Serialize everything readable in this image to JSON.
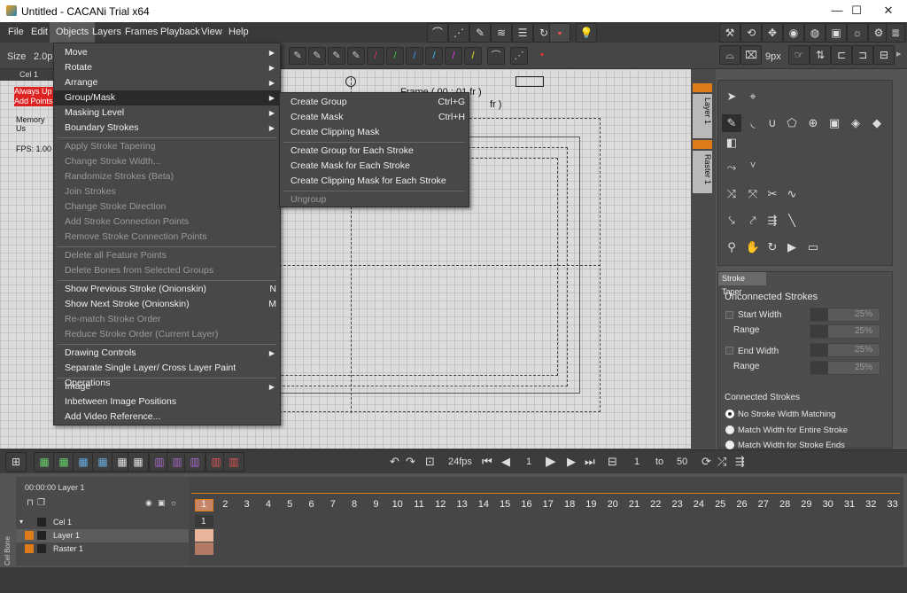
{
  "window": {
    "title": "Untitled - CACANi Trial  x64",
    "minimize": "—",
    "maximize": "☐",
    "close": "✕"
  },
  "menubar": {
    "items": [
      "File",
      "Edit",
      "Objects",
      "Layers",
      "Frames",
      "Playback",
      "View",
      "Help"
    ],
    "active": "Objects"
  },
  "toolbar": {
    "size_label": "Size",
    "size_value": "2.0px",
    "brush_size": "9px"
  },
  "left_info": {
    "cel_label": "Cel 1",
    "always_up": "Always Up",
    "add_points": "Add Points",
    "memory": "Memory Us",
    "fps": "FPS: 1.00"
  },
  "canvas": {
    "frame_text": "Frame ( 00 : 01 fr )",
    "fr_text": "fr )"
  },
  "right_tabs": {
    "layer1": "Layer 1",
    "raster1": "Raster 1"
  },
  "objects_menu": [
    {
      "label": "Move",
      "arrow": true,
      "disabled": false
    },
    {
      "label": "Rotate",
      "arrow": true,
      "disabled": false
    },
    {
      "label": "Arrange",
      "arrow": true,
      "disabled": false
    },
    {
      "label": "Group/Mask",
      "arrow": true,
      "disabled": false,
      "selected": true
    },
    {
      "label": "Masking Level",
      "arrow": true,
      "disabled": false
    },
    {
      "label": "Boundary Strokes",
      "arrow": true,
      "disabled": false
    },
    {
      "label": "Apply Stroke Tapering",
      "disabled": true
    },
    {
      "label": "Change Stroke Width...",
      "disabled": true
    },
    {
      "label": "Randomize Strokes (Beta)",
      "disabled": true
    },
    {
      "label": "Join Strokes",
      "disabled": true
    },
    {
      "label": "Change Stroke Direction",
      "disabled": true
    },
    {
      "label": "Add Stroke Connection Points",
      "disabled": true
    },
    {
      "label": "Remove Stroke Connection Points",
      "disabled": true
    },
    {
      "label": "Delete all Feature Points",
      "disabled": true
    },
    {
      "label": "Delete Bones from Selected Groups",
      "disabled": true
    },
    {
      "label": "Show Previous Stroke (Onionskin)",
      "shortcut": "N",
      "disabled": false
    },
    {
      "label": "Show Next Stroke (Onionskin)",
      "shortcut": "M",
      "disabled": false
    },
    {
      "label": "Re-match Stroke Order",
      "disabled": true
    },
    {
      "label": "Reduce Stroke Order (Current Layer)",
      "disabled": true
    },
    {
      "label": "Drawing Controls",
      "arrow": true,
      "disabled": false
    },
    {
      "label": "Separate Single Layer/ Cross Layer Paint Operations",
      "disabled": false
    },
    {
      "label": "Image",
      "arrow": true,
      "disabled": false
    },
    {
      "label": "Inbetween Image Positions",
      "disabled": false
    },
    {
      "label": "Add Video Reference...",
      "disabled": false
    }
  ],
  "group_mask_submenu": [
    {
      "label": "Create Group",
      "shortcut": "Ctrl+G",
      "disabled": false
    },
    {
      "label": "Create Mask",
      "shortcut": "Ctrl+H",
      "disabled": false
    },
    {
      "label": "Create Clipping Mask",
      "disabled": false
    },
    {
      "label": "Create Group for Each Stroke",
      "disabled": false
    },
    {
      "label": "Create Mask for Each Stroke",
      "disabled": false
    },
    {
      "label": "Create Clipping Mask for Each Stroke",
      "disabled": false
    },
    {
      "label": "Ungroup",
      "disabled": true
    }
  ],
  "stroke_taper": {
    "tab": "Stroke Taper",
    "unconnected": "Unconnected Strokes",
    "start_width": "Start Width",
    "start_width_val": "25%",
    "range1": "Range",
    "range1_val": "25%",
    "end_width": "End Width",
    "end_width_val": "25%",
    "range2": "Range",
    "range2_val": "25%",
    "connected": "Connected Strokes",
    "opt1": "No Stroke Width Matching",
    "opt2": "Match Width for Entire Stroke",
    "opt3": "Match Width for Stroke Ends"
  },
  "playback": {
    "fps": "24fps",
    "current": "1",
    "from": "1",
    "to_label": "to",
    "to": "50"
  },
  "timeline": {
    "timecode": "00:00:00  Layer 1",
    "layers": [
      "Cel 1",
      "Layer 1",
      "Raster 1"
    ],
    "side_tab": "Cel Bone",
    "frames": [
      "1",
      "2",
      "3",
      "4",
      "5",
      "6",
      "7",
      "8",
      "9",
      "10",
      "11",
      "12",
      "13",
      "14",
      "15",
      "16",
      "17",
      "18",
      "19",
      "20",
      "21",
      "22",
      "23",
      "24",
      "25",
      "26",
      "27",
      "28",
      "29",
      "30",
      "31",
      "32",
      "33"
    ]
  },
  "colors": {
    "accent": "#e07b1a",
    "menu_bg": "#484848",
    "canvas": "#dcdcdc"
  }
}
